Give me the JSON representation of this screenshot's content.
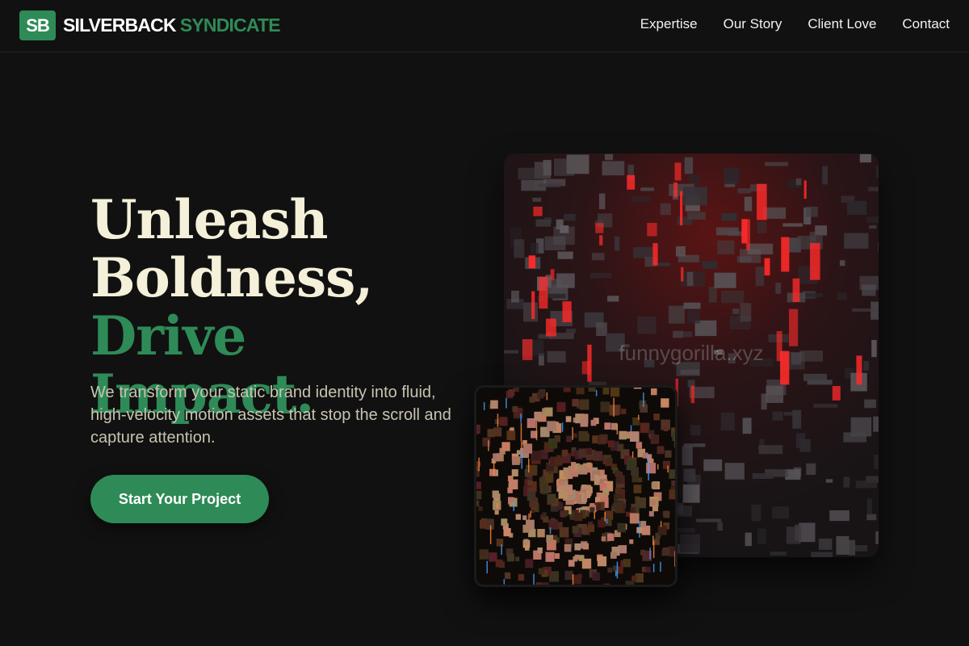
{
  "brand": {
    "badge": "SB",
    "name_part1": "SILVERBACK",
    "name_part2": "SYNDICATE",
    "accent_color": "#2e8b57"
  },
  "nav": {
    "items": [
      {
        "label": "Expertise"
      },
      {
        "label": "Our Story"
      },
      {
        "label": "Client Love"
      },
      {
        "label": "Contact"
      }
    ]
  },
  "hero": {
    "headline_line1": "Unleash",
    "headline_line2": "Boldness,",
    "headline_accent": "Drive Impact.",
    "subtext": "We transform your static brand identity into fluid, high-velocity motion assets that stop the scroll and capture attention.",
    "cta_label": "Start Your Project"
  },
  "media": {
    "main_image": {
      "description_icon": "isometric-city-image",
      "watermark": "funnygorilla.xyz"
    },
    "small_image": {
      "description_icon": "spiral-blocks-image"
    }
  },
  "colors": {
    "background": "#111111",
    "headline": "#f4f0d9",
    "subtext": "#c9c4b0",
    "city_glow": "#ff2a2a"
  }
}
